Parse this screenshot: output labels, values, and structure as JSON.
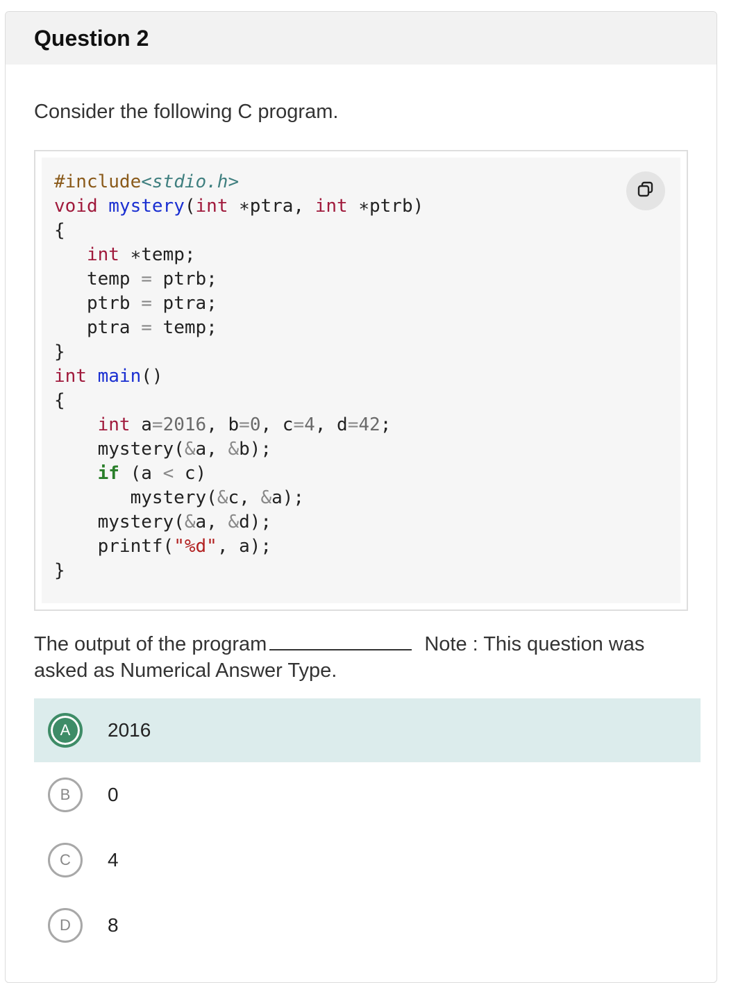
{
  "question": {
    "title": "Question 2",
    "prompt": "Consider the following C program.",
    "text_before_blank": "The output of the program",
    "text_after_blank": "Note : This question was asked as Numerical Answer Type."
  },
  "code_lines": [
    [
      "#include",
      "<stdio.h>"
    ],
    [
      "void",
      " ",
      "mystery",
      "(",
      "int",
      " ∗ptra, ",
      "int",
      " ∗ptrb)"
    ],
    [
      "{"
    ],
    [
      "   ",
      "int",
      " ∗temp;"
    ],
    [
      "   temp ",
      "=",
      " ptrb;"
    ],
    [
      "   ptrb ",
      "=",
      " ptra;"
    ],
    [
      "   ptra ",
      "=",
      " temp;"
    ],
    [
      "}"
    ],
    [
      "int",
      " ",
      "main",
      "()"
    ],
    [
      "{"
    ],
    [
      "    ",
      "int",
      " a",
      "=",
      "2016",
      ", b",
      "=",
      "0",
      ", c",
      "=",
      "4",
      ", d",
      "=",
      "42",
      ";"
    ],
    [
      "    mystery(",
      "&",
      "a, ",
      "&",
      "b);"
    ],
    [
      "    ",
      "if",
      " (a ",
      "<",
      " c)"
    ],
    [
      "       mystery(",
      "&",
      "c, ",
      "&",
      "a);"
    ],
    [
      "    mystery(",
      "&",
      "a, ",
      "&",
      "d);"
    ],
    [
      "    printf(",
      "\"%d\"",
      ", a);"
    ],
    [
      "}"
    ]
  ],
  "copy_button": {
    "icon": "copy-icon"
  },
  "options": [
    {
      "letter": "A",
      "value": "2016",
      "correct": true
    },
    {
      "letter": "B",
      "value": "0",
      "correct": false
    },
    {
      "letter": "C",
      "value": "4",
      "correct": false
    },
    {
      "letter": "D",
      "value": "8",
      "correct": false
    }
  ],
  "colors": {
    "correct_bg": "#dcecec",
    "correct_badge": "#3e8c67",
    "keyword": "#a01a3c",
    "function": "#1a2fd1"
  }
}
